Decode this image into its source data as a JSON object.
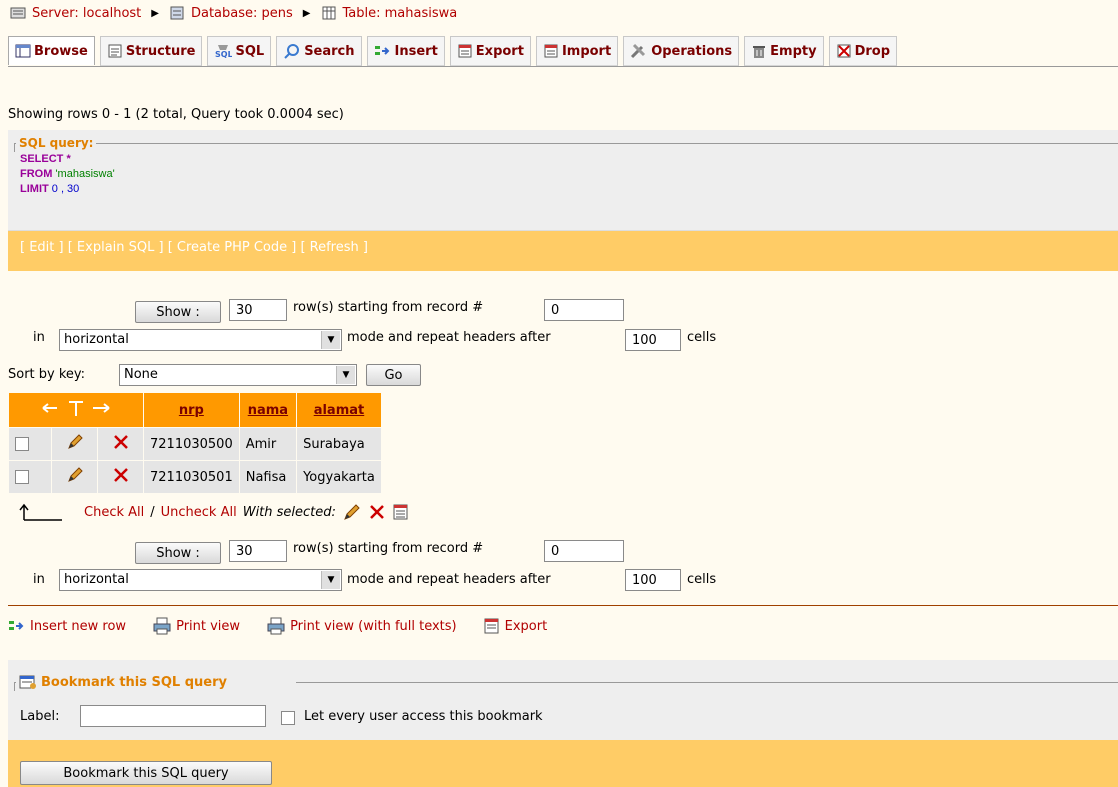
{
  "breadcrumb": {
    "server": "Server: localhost",
    "database": "Database: pens",
    "table": "Table: mahasiswa"
  },
  "tabs": [
    {
      "label": "Browse",
      "icon": "browse-icon",
      "active": true
    },
    {
      "label": "Structure",
      "icon": "structure-icon"
    },
    {
      "label": "SQL",
      "icon": "sql-icon"
    },
    {
      "label": "Search",
      "icon": "search-icon"
    },
    {
      "label": "Insert",
      "icon": "insert-icon"
    },
    {
      "label": "Export",
      "icon": "export-icon"
    },
    {
      "label": "Import",
      "icon": "import-icon"
    },
    {
      "label": "Operations",
      "icon": "operations-icon"
    },
    {
      "label": "Empty",
      "icon": "empty-icon"
    },
    {
      "label": "Drop",
      "icon": "drop-icon"
    }
  ],
  "status": "Showing rows 0 - 1 (2 total, Query took 0.0004 sec)",
  "sql": {
    "legend": "SQL query:",
    "select_kw": "SELECT",
    "select_rest": " *",
    "from_kw": "FROM",
    "from_table": " 'mahasiswa'",
    "limit_kw": "LIMIT",
    "limit_val": " 0 , 30",
    "actions": "[ Edit ] [ Explain SQL ] [ Create PHP Code ] [ Refresh ]"
  },
  "nav": {
    "show_label": "Show :",
    "rows_value": "30",
    "rows_text": "row(s) starting from record #",
    "start_value": "0",
    "in_text": "in",
    "mode_value": "horizontal",
    "repeat_text": "mode and repeat headers after",
    "repeat_value": "100",
    "cells_text": "cells"
  },
  "sort": {
    "label": "Sort by key:",
    "value": "None",
    "go": "Go"
  },
  "table": {
    "headers": [
      "nrp",
      "nama",
      "alamat"
    ],
    "rows": [
      {
        "nrp": "7211030500",
        "nama": "Amir",
        "alamat": "Surabaya"
      },
      {
        "nrp": "7211030501",
        "nama": "Nafisa",
        "alamat": "Yogyakarta"
      }
    ]
  },
  "selection": {
    "check_all": "Check All",
    "sep": "/",
    "uncheck_all": "Uncheck All",
    "with_selected": "With selected:"
  },
  "bottom_links": {
    "insert": "Insert new row",
    "print": "Print view",
    "print_full": "Print view (with full texts)",
    "export": "Export"
  },
  "bookmark": {
    "legend": "Bookmark this SQL query",
    "label": "Label:",
    "label_value": "",
    "checkbox_text": "Let every user access this bookmark",
    "button": "Bookmark this SQL query"
  },
  "colors": {
    "header_orange": "#ff9900",
    "action_bar": "#ffcc66",
    "link_red": "#b10000",
    "page_bg": "#fffbf0"
  }
}
